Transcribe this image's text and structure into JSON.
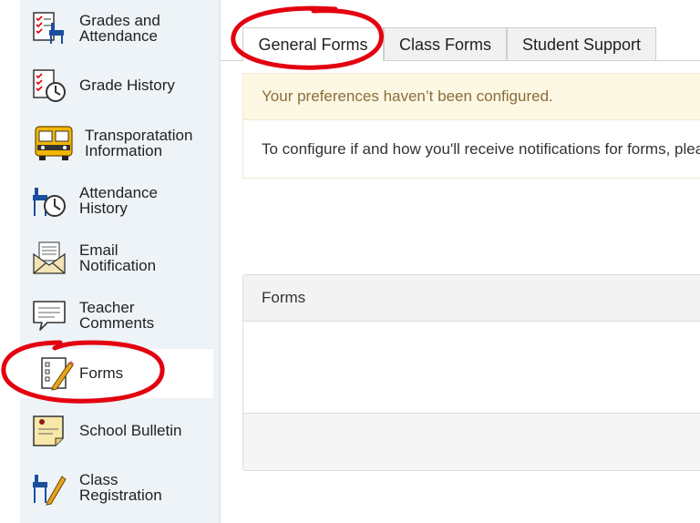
{
  "sidebar": {
    "items": [
      {
        "label_line1": "Grades and",
        "label_line2": "Attendance",
        "icon": "grades-attendance-icon"
      },
      {
        "label_line1": "Grade History",
        "label_line2": "",
        "icon": "grade-history-icon"
      },
      {
        "label_line1": "Transporatation",
        "label_line2": "Information",
        "icon": "school-bus-icon"
      },
      {
        "label_line1": "Attendance",
        "label_line2": "History",
        "icon": "attendance-history-icon"
      },
      {
        "label_line1": "Email",
        "label_line2": "Notification",
        "icon": "email-envelope-icon"
      },
      {
        "label_line1": "Teacher",
        "label_line2": "Comments",
        "icon": "speech-bubble-icon"
      },
      {
        "label_line1": "Forms",
        "label_line2": "",
        "icon": "forms-checklist-icon",
        "active": true
      },
      {
        "label_line1": "School Bulletin",
        "label_line2": "",
        "icon": "bulletin-icon"
      },
      {
        "label_line1": "Class",
        "label_line2": "Registration",
        "icon": "class-registration-icon"
      }
    ]
  },
  "tabs": [
    {
      "label": "General Forms",
      "active": true
    },
    {
      "label": "Class Forms",
      "active": false
    },
    {
      "label": "Student Support",
      "active": false
    }
  ],
  "alert": {
    "header": "Your preferences haven’t been configured.",
    "body": "To configure if and how you'll receive notifications for forms, please"
  },
  "forms_panel": {
    "header": "Forms"
  },
  "colors": {
    "annotation": "#e3000f",
    "sidebar_bg": "#eef3f8",
    "alert_bg": "#fcf8e3",
    "alert_text": "#8a6d3b"
  }
}
